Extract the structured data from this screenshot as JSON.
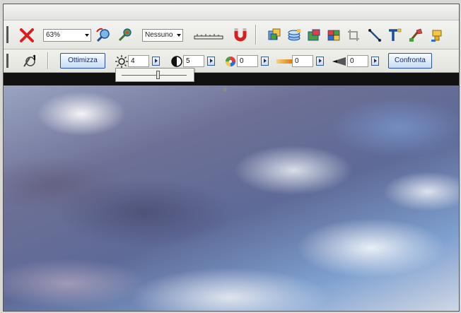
{
  "toolbar": {
    "zoom_value": "63%",
    "selection_value": "Nessuno"
  },
  "adjust": {
    "optimize_label": "Ottimizza",
    "brightness": "4",
    "contrast": "5",
    "saturation": "0",
    "field4": "0",
    "field5": "0",
    "compare_label": "Confronta",
    "brightness_slider": 0.55
  },
  "colors": {
    "accent_blue": "#2e4f9a",
    "delete_red": "#d62020"
  }
}
